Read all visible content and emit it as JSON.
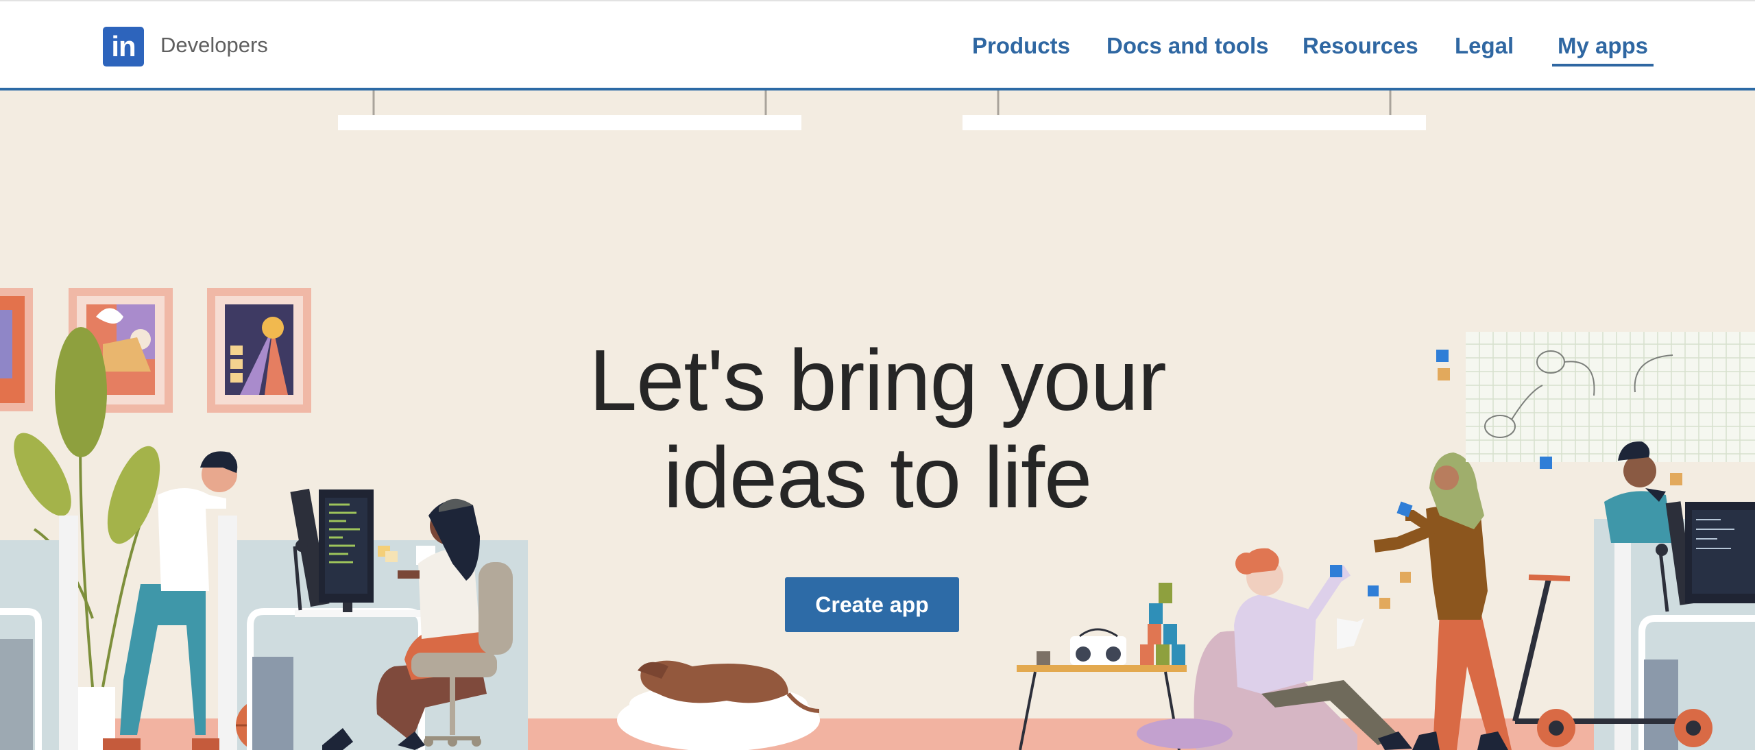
{
  "header": {
    "logo_text": "in",
    "brand": "Developers",
    "nav": [
      {
        "label": "Products"
      },
      {
        "label": "Docs and tools"
      },
      {
        "label": "Resources"
      },
      {
        "label": "Legal"
      },
      {
        "label": "My apps",
        "active": true
      }
    ]
  },
  "hero": {
    "title_line1": "Let's bring your",
    "title_line2": "ideas to life",
    "cta_label": "Create app"
  },
  "colors": {
    "brand_blue": "#2d64bc",
    "nav_blue": "#2f67a2",
    "background": "#f3ece1",
    "floor": "#f2b3a1"
  }
}
